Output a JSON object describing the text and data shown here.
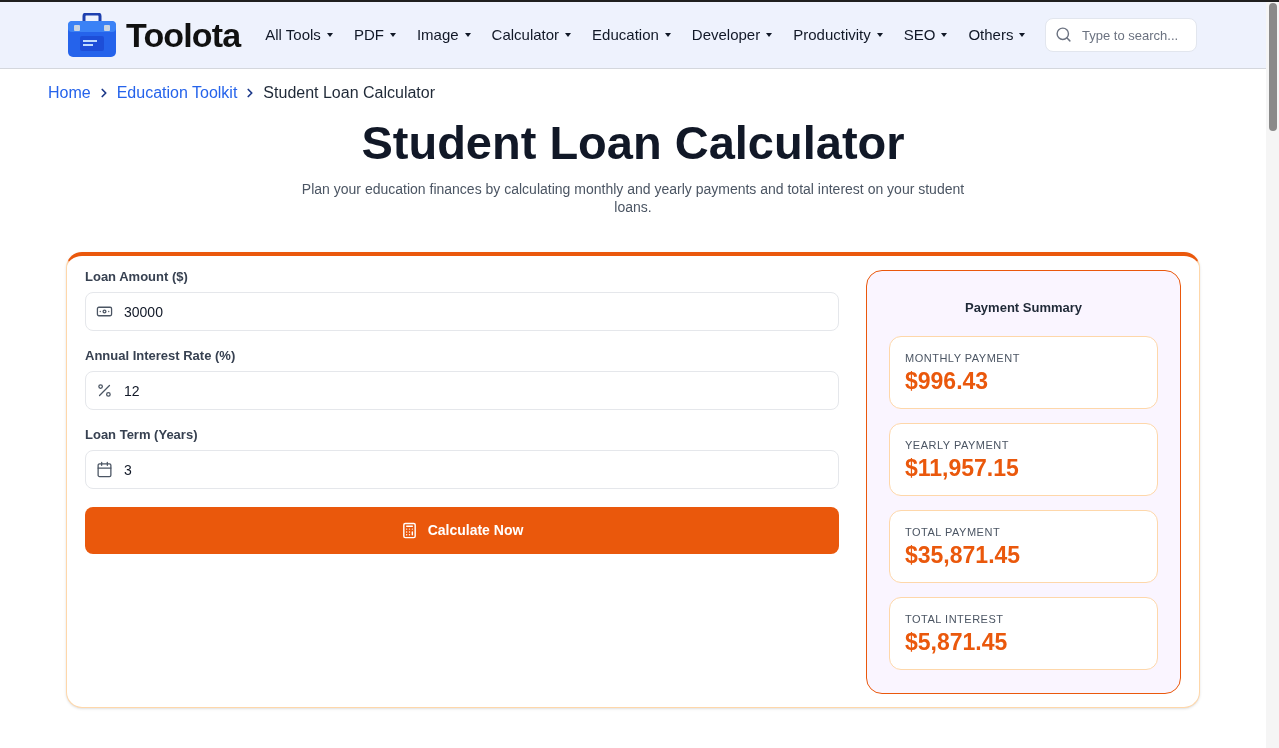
{
  "header": {
    "brand": "Toolota",
    "nav": [
      {
        "label": "All Tools"
      },
      {
        "label": "PDF"
      },
      {
        "label": "Image"
      },
      {
        "label": "Calculator"
      },
      {
        "label": "Education"
      },
      {
        "label": "Developer"
      },
      {
        "label": "Productivity"
      },
      {
        "label": "SEO"
      },
      {
        "label": "Others"
      }
    ],
    "search": {
      "placeholder": "Type to search..."
    }
  },
  "breadcrumb": [
    {
      "label": "Home",
      "kind": "link"
    },
    {
      "label": "Education Toolkit",
      "kind": "link"
    },
    {
      "label": "Student Loan Calculator",
      "kind": "current"
    }
  ],
  "page": {
    "title": "Student Loan Calculator",
    "subtitle": "Plan your education finances by calculating monthly and yearly payments and total interest on your student loans."
  },
  "form": {
    "fields": [
      {
        "label": "Loan Amount ($)",
        "value": "30000",
        "kind": "amount"
      },
      {
        "label": "Annual Interest Rate (%)",
        "value": "12",
        "kind": "rate"
      },
      {
        "label": "Loan Term (Years)",
        "value": "3",
        "kind": "term"
      }
    ],
    "button": {
      "label": "Calculate Now"
    }
  },
  "summary": {
    "title": "Payment Summary",
    "items": [
      {
        "label": "MONTHLY PAYMENT",
        "value": "$996.43"
      },
      {
        "label": "YEARLY PAYMENT",
        "value": "$11,957.15"
      },
      {
        "label": "TOTAL PAYMENT",
        "value": "$35,871.45"
      },
      {
        "label": "TOTAL INTEREST",
        "value": "$5,871.45"
      }
    ]
  }
}
